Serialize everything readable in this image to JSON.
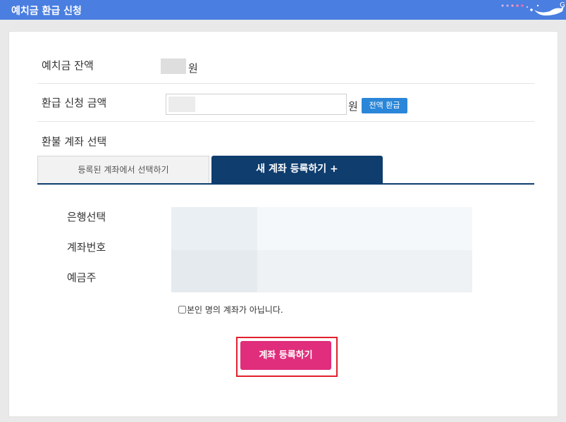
{
  "header": {
    "title": "예치금 환급 신청",
    "accent_color": "#4a7ee0"
  },
  "balance": {
    "label": "예치금 잔액",
    "unit": "원"
  },
  "refund_amount": {
    "label": "환급 신청 금액",
    "value": "",
    "unit": "원",
    "full_refund_button": "전액 환급"
  },
  "account_select": {
    "label": "환불 계좌 선택",
    "tabs": [
      {
        "label": "등록된 계좌에서 선택하기",
        "active": false
      },
      {
        "label": "새 계좌 등록하기 +",
        "active": true
      }
    ]
  },
  "new_account_form": {
    "fields": [
      {
        "label": "은행선택"
      },
      {
        "label": "계좌번호"
      },
      {
        "label": "예금주"
      }
    ],
    "not_own_account_checkbox": {
      "label": "본인 명의 계좌가 아닙니다.",
      "checked": false
    },
    "submit_button": "계좌 등록하기",
    "submit_color": "#e02e7c"
  }
}
